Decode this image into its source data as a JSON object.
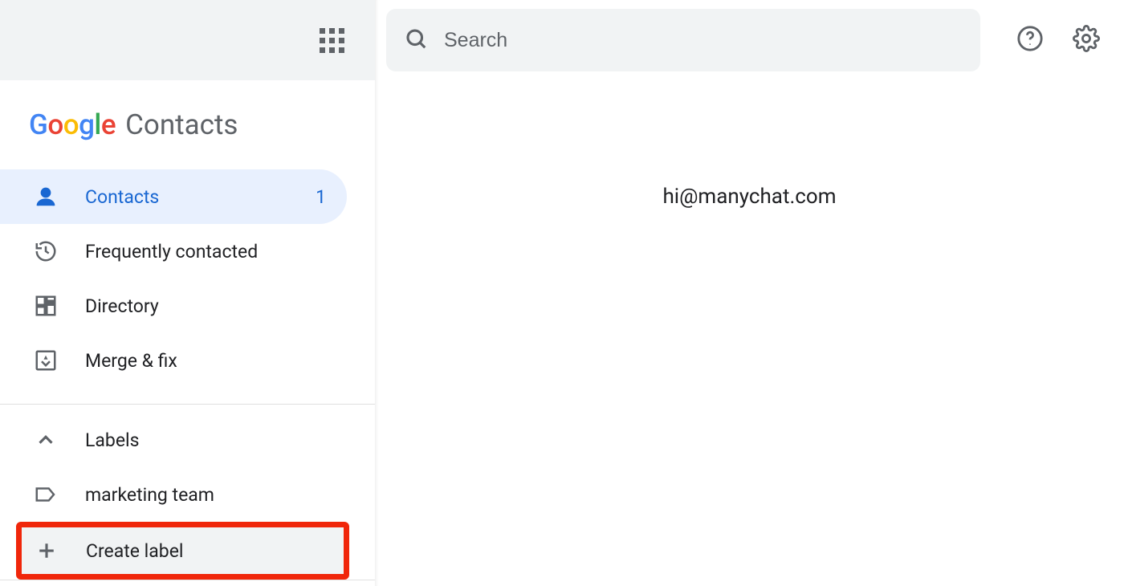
{
  "brand": {
    "g": "G",
    "o1": "o",
    "o2": "o",
    "g2": "g",
    "l": "l",
    "e": "e",
    "product": "Contacts"
  },
  "search": {
    "placeholder": "Search"
  },
  "sidebar": {
    "items": [
      {
        "label": "Contacts",
        "count": "1"
      },
      {
        "label": "Frequently contacted"
      },
      {
        "label": "Directory"
      },
      {
        "label": "Merge & fix"
      }
    ],
    "labels_header": "Labels",
    "labels": [
      {
        "label": "marketing team"
      }
    ],
    "create_label": "Create label"
  },
  "main": {
    "contact_email": "hi@manychat.com"
  }
}
